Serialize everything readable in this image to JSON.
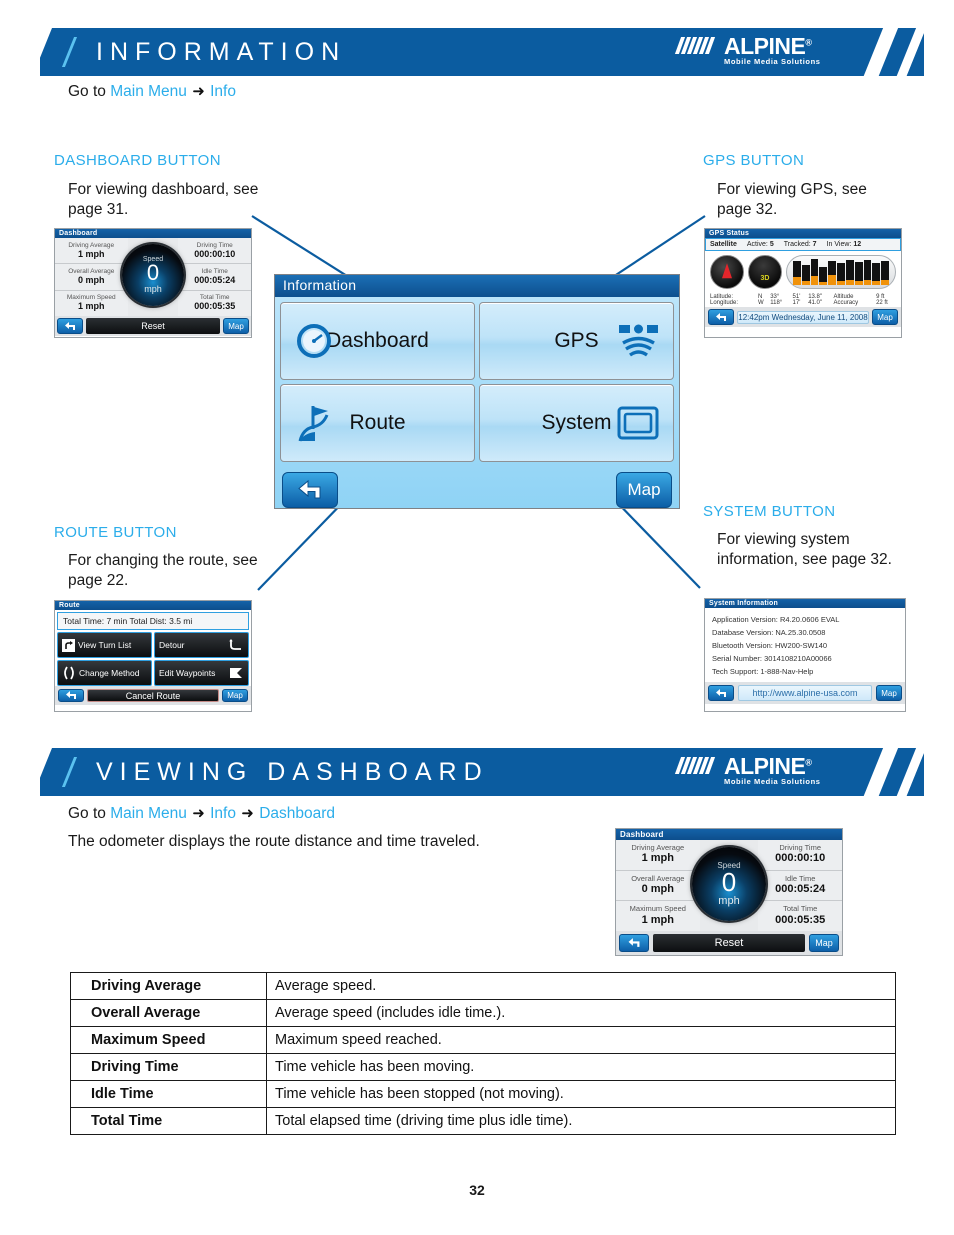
{
  "page": {
    "number": "32"
  },
  "sections": [
    {
      "id": "information",
      "title": "INFORMATION",
      "breadcrumb": {
        "prefix": "Go to",
        "items": [
          "Main Menu",
          "Info"
        ]
      }
    },
    {
      "id": "viewing-dashboard",
      "title": "VIEWING DASHBOARD",
      "breadcrumb": {
        "prefix": "Go to",
        "items": [
          "Main Menu",
          "Info",
          "Dashboard"
        ]
      },
      "intro": "The odometer displays the route distance and time traveled."
    }
  ],
  "logo": {
    "word": "ALPINE",
    "registered": "®",
    "tagline": "Mobile Media Solutions"
  },
  "callouts": {
    "dashboard": {
      "title": "DASHBOARD BUTTON",
      "body": "For viewing dashboard, see page 31."
    },
    "gps": {
      "title": "GPS BUTTON",
      "body": "For viewing GPS, see page 32."
    },
    "route": {
      "title": "ROUTE BUTTON",
      "body": "For changing the route, see page 22."
    },
    "system": {
      "title": "SYSTEM BUTTON",
      "body": "For viewing system information, see page 32."
    }
  },
  "info_screen": {
    "title": "Information",
    "buttons": [
      {
        "label": "Dashboard",
        "icon": "gauge-icon"
      },
      {
        "label": "GPS",
        "icon": "satellite-icon"
      },
      {
        "label": "Route",
        "icon": "flag-route-icon"
      },
      {
        "label": "System",
        "icon": "screen-icon"
      }
    ],
    "back_label": "back-arrow-icon",
    "map_label": "Map"
  },
  "dashboard_screen": {
    "title": "Dashboard",
    "left": [
      {
        "label": "Driving Average",
        "value": "1 mph"
      },
      {
        "label": "Overall Average",
        "value": "0 mph"
      },
      {
        "label": "Maximum Speed",
        "value": "1 mph"
      }
    ],
    "right": [
      {
        "label": "Driving Time",
        "value": "000:00:10"
      },
      {
        "label": "Idle Time",
        "value": "000:05:24"
      },
      {
        "label": "Total Time",
        "value": "000:05:35"
      }
    ],
    "gauge": {
      "caption": "Speed",
      "value": "0",
      "unit": "mph"
    },
    "reset_label": "Reset",
    "map_label": "Map"
  },
  "gps_screen": {
    "title": "GPS Status",
    "status": {
      "name": "Satellite",
      "active_label": "Active:",
      "active": "5",
      "tracked_label": "Tracked:",
      "tracked": "7",
      "inview_label": "In View:",
      "inview": "12"
    },
    "mode": "3D",
    "coords": [
      {
        "label": "Latitude:",
        "v1": "N",
        "v2": "33°",
        "v3": "51'",
        "v4": "13.8\"",
        "label2": "Altitude",
        "v5": "9 ft"
      },
      {
        "label": "Longitude:",
        "v1": "W",
        "v2": "118°",
        "v3": "17'",
        "v4": "41.0\"",
        "label2": "Accuracy",
        "v5": "22 ft"
      }
    ],
    "timestamp": "12:42pm Wednesday, June 11, 2008",
    "map_label": "Map"
  },
  "route_screen": {
    "title": "Route",
    "summary": "Total Time: 7 min  Total Dist: 3.5 mi",
    "buttons": [
      "View Turn List",
      "Detour",
      "Change Method",
      "Edit Waypoints"
    ],
    "cancel_label": "Cancel Route",
    "map_label": "Map"
  },
  "system_screen": {
    "title": "System Information",
    "lines": [
      "Application Version: R4.20.0606 EVAL",
      "Database Version: NA.25.30.0508",
      "Bluetooth Version: HW200-SW140",
      "Serial Number: 3014108210A00066",
      "Tech Support: 1-888-Nav-Help"
    ],
    "url": "http://www.alpine-usa.com",
    "map_label": "Map"
  },
  "spec_table": {
    "rows": [
      {
        "key": "Driving Average",
        "desc": "Average speed."
      },
      {
        "key": "Overall Average",
        "desc": "Average speed (includes idle time.)."
      },
      {
        "key": "Maximum Speed",
        "desc": "Maximum speed reached."
      },
      {
        "key": "Driving Time",
        "desc": "Time vehicle has been moving."
      },
      {
        "key": "Idle Time",
        "desc": "Time vehicle has been stopped (not moving)."
      },
      {
        "key": "Total Time",
        "desc": "Total elapsed time (driving time plus idle time)."
      }
    ]
  },
  "colors": {
    "brand_blue": "#0b5ca0",
    "accent_cyan": "#2badea",
    "link": "#2badea"
  }
}
